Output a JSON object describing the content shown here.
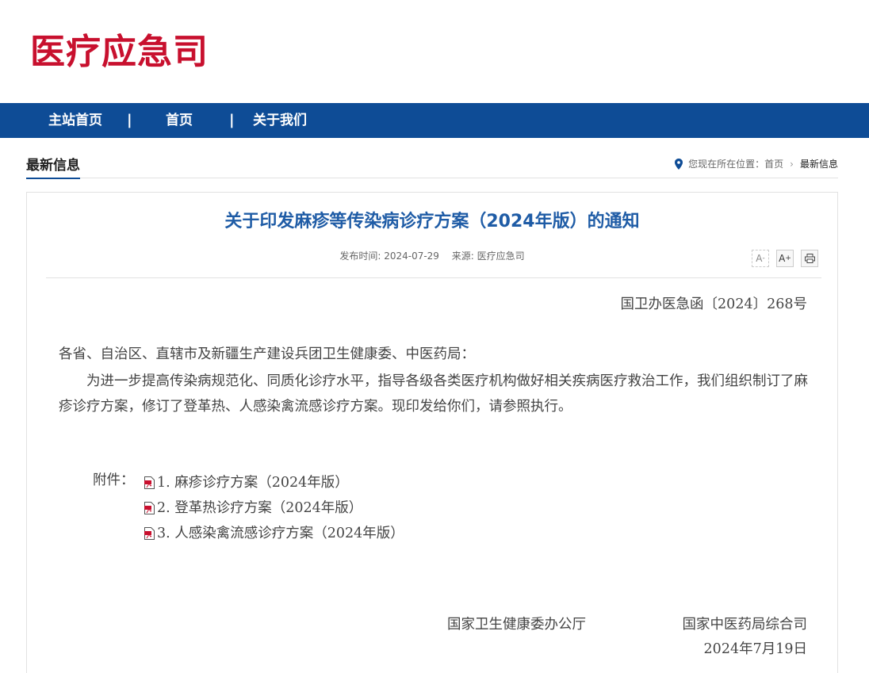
{
  "header": {
    "logo_text": "医疗应急司"
  },
  "nav": {
    "items": [
      "主站首页",
      "首页",
      "关于我们"
    ],
    "separator": "|"
  },
  "section": {
    "title": "最新信息",
    "breadcrumb": {
      "label": "您现在所在位置：",
      "home": "首页",
      "sep": "›",
      "current": "最新信息"
    }
  },
  "article": {
    "title": "关于印发麻疹等传染病诊疗方案（2024年版）的通知",
    "meta": {
      "date": "发布时间:  2024-07-29",
      "source": "来源: 医疗应急司"
    },
    "tools": {
      "font_smaller": "A",
      "font_larger": "A",
      "font_larger_sup": "+"
    },
    "doc_number": "国卫办医急函〔2024〕268号",
    "salutation": "各省、自治区、直辖市及新疆生产建设兵团卫生健康委、中医药局：",
    "body": "为进一步提高传染病规范化、同质化诊疗水平，指导各级各类医疗机构做好相关疾病医疗救治工作，我们组织制订了麻疹诊疗方案，修订了登革热、人感染禽流感诊疗方案。现印发给你们，请参照执行。",
    "attachments_label": "附件：",
    "attachments": [
      "1. 麻疹诊疗方案（2024年版）",
      "2. 登革热诊疗方案（2024年版）",
      "3. 人感染禽流感诊疗方案（2024年版）"
    ],
    "signatures": [
      "国家卫生健康委办公厅",
      "国家中医药局综合司"
    ],
    "sign_date": "2024年7月19日"
  },
  "colors": {
    "brand_red": "#c8102e",
    "nav_blue": "#0e4c96",
    "title_blue": "#1f5ca6"
  }
}
